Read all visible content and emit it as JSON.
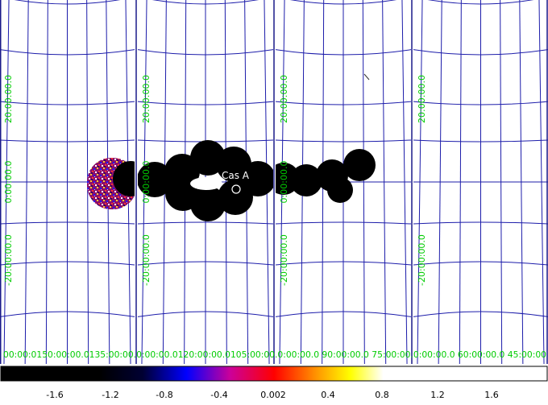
{
  "colors": {
    "background": "#ffffff",
    "grid_line": "#1c1caa",
    "frame_border": "#1a1a8a",
    "tick_label": "#00cc00",
    "source_blobs": "#000000",
    "source_label": "#ffffff",
    "colorbar_border": "#000000"
  },
  "panels": [
    {
      "id": "panel-1",
      "y_ticks": [
        "20:00:00.0",
        "0:00:00.0",
        "-20:00:00.0"
      ],
      "x_ticks": [
        "180:00:00.0",
        "150:00:00.0",
        "135:00:00.0"
      ]
    },
    {
      "id": "panel-2",
      "y_ticks": [
        "20:00:00.0",
        "0:00:00.0",
        "-20:00:00.0"
      ],
      "x_ticks": [
        "120:00:00.0",
        "105:00:00.0"
      ]
    },
    {
      "id": "panel-3",
      "y_ticks": [
        "20:00:00.0",
        "0:00:00.0",
        "-20:00:00.0"
      ],
      "x_ticks": [
        "90:00:00.0",
        "75:00:00.0"
      ]
    },
    {
      "id": "panel-4",
      "y_ticks": [
        "20:00:00.0",
        "-20:00:00.0"
      ],
      "x_ticks": [
        "60:00:00.0",
        "45:00:00.0"
      ]
    }
  ],
  "x_axis_strip_text": "00:00:0150:00:00.0135:00:00.0:00:00.0120:00:00.0105:00:00.0:00:00.0  90:00:00.0  75:00:00.0:00:00.0  60:00:00.0  45:00:00",
  "source": {
    "name": "Cas A",
    "marker": "circle-marker"
  },
  "colorbar": {
    "ticks": [
      "-1.6",
      "-1.2",
      "-0.8",
      "-0.4",
      "0.002",
      "0.4",
      "0.8",
      "1.2",
      "1.6"
    ],
    "colormap": [
      "#000000",
      "#000000",
      "#000033",
      "#0000ff",
      "#cc0099",
      "#ff0000",
      "#ff9900",
      "#ffff00",
      "#ffffff",
      "#ffffff"
    ]
  }
}
